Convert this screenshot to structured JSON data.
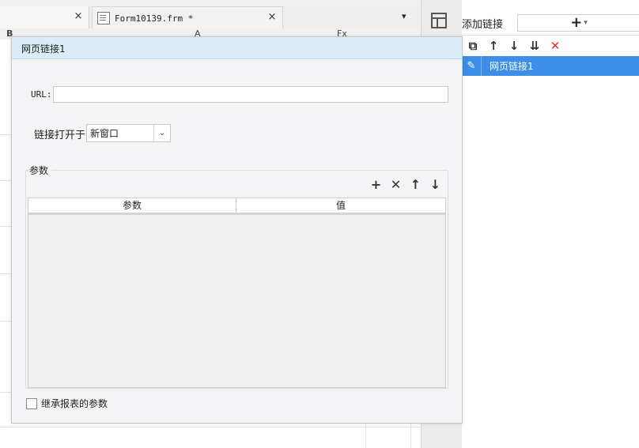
{
  "tabs": {
    "left_close": "×",
    "file_tab": {
      "title": "Form10139.frm *",
      "close": "×"
    },
    "dropdown_glyph": "▾"
  },
  "toolbar": {
    "bold": "B",
    "glyph_a": "A",
    "glyph_fx": "Fx"
  },
  "right_panel": {
    "add_link_label": "添加链接",
    "add_button_plus": "+",
    "add_button_caret": "▾",
    "tools": {
      "copy": "⧉",
      "up": "↑",
      "down": "↓",
      "sort": "⇊",
      "delete": "✕"
    },
    "items": [
      {
        "label": "网页链接1",
        "icon": "✎"
      }
    ]
  },
  "dialog": {
    "title": "网页链接1",
    "url_label": "URL:",
    "url_value": "",
    "open_in_label": "链接打开于",
    "open_in_value": "新窗口",
    "select_arrow": "⌄",
    "params_title": "参数",
    "param_tools": {
      "add": "+",
      "delete": "✕",
      "up": "↑",
      "down": "↓"
    },
    "table_headers": [
      "参数",
      "值"
    ],
    "table_rows": [],
    "inherit_label": "继承报表的参数",
    "inherit_checked": false
  },
  "colors": {
    "dialog_header": "#d9ecf8",
    "selection": "#3d8ee6",
    "delete_red": "#e52b2b"
  }
}
